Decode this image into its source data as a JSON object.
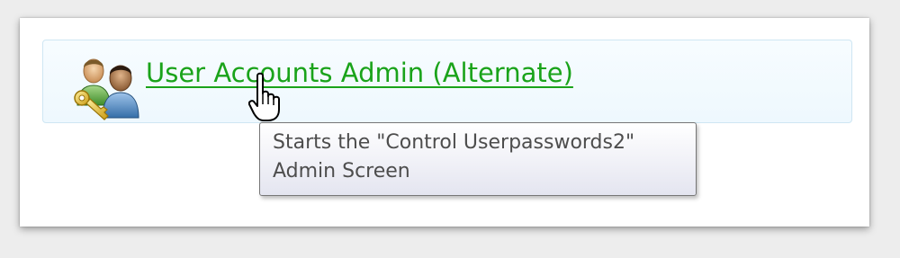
{
  "task": {
    "link_label": "User Accounts Admin (Alternate)",
    "icon": "user-accounts-icon"
  },
  "tooltip": {
    "line1": "Starts the \"Control Userpasswords2\"",
    "line2": "Admin Screen"
  },
  "cursor": {
    "icon": "hand-pointer-icon"
  },
  "colors": {
    "link": "#1aa31a",
    "row_border": "#cfe6f3",
    "row_background": "#eef8fe",
    "tooltip_border": "#767676",
    "tooltip_text": "#4d4d4d"
  }
}
